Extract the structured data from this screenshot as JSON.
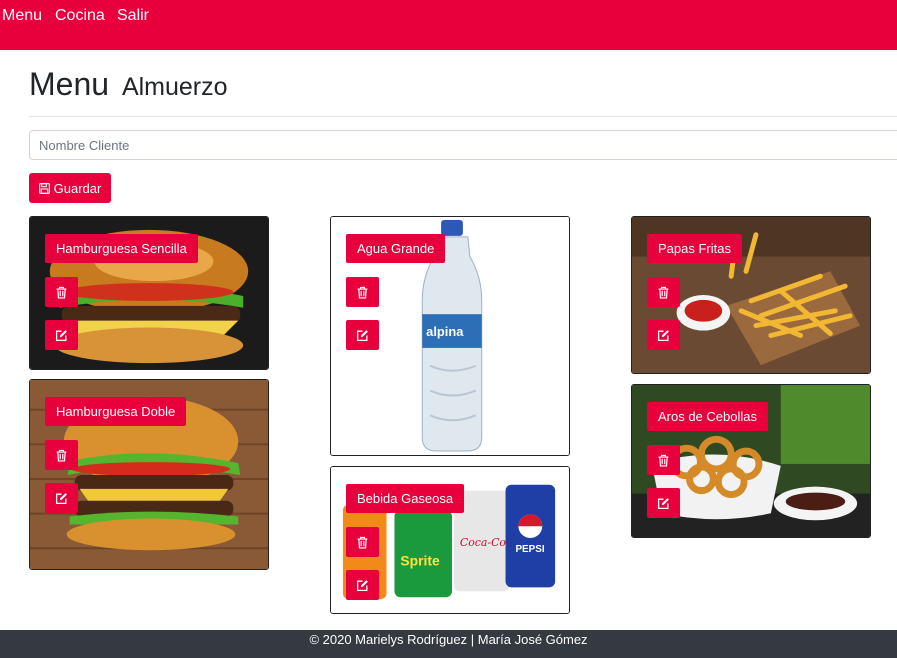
{
  "nav": {
    "items": [
      "Menu",
      "Cocina",
      "Salir"
    ]
  },
  "page": {
    "title": "Menu",
    "subtitle": "Almuerzo"
  },
  "form": {
    "client_placeholder": "Nombre Cliente",
    "client_value": "",
    "save_label": "Guardar"
  },
  "products": [
    {
      "name": "Hamburguesa Sencilla"
    },
    {
      "name": "Agua Grande"
    },
    {
      "name": "Papas Fritas"
    },
    {
      "name": "Hamburguesa Doble"
    },
    {
      "name": "Bebida Gaseosa"
    },
    {
      "name": "Aros de Cebollas"
    }
  ],
  "footer": {
    "text": "© 2020 Marielys Rodríguez | María José Gómez"
  },
  "colors": {
    "accent": "#e8003d",
    "footer_bg": "#343a40"
  }
}
